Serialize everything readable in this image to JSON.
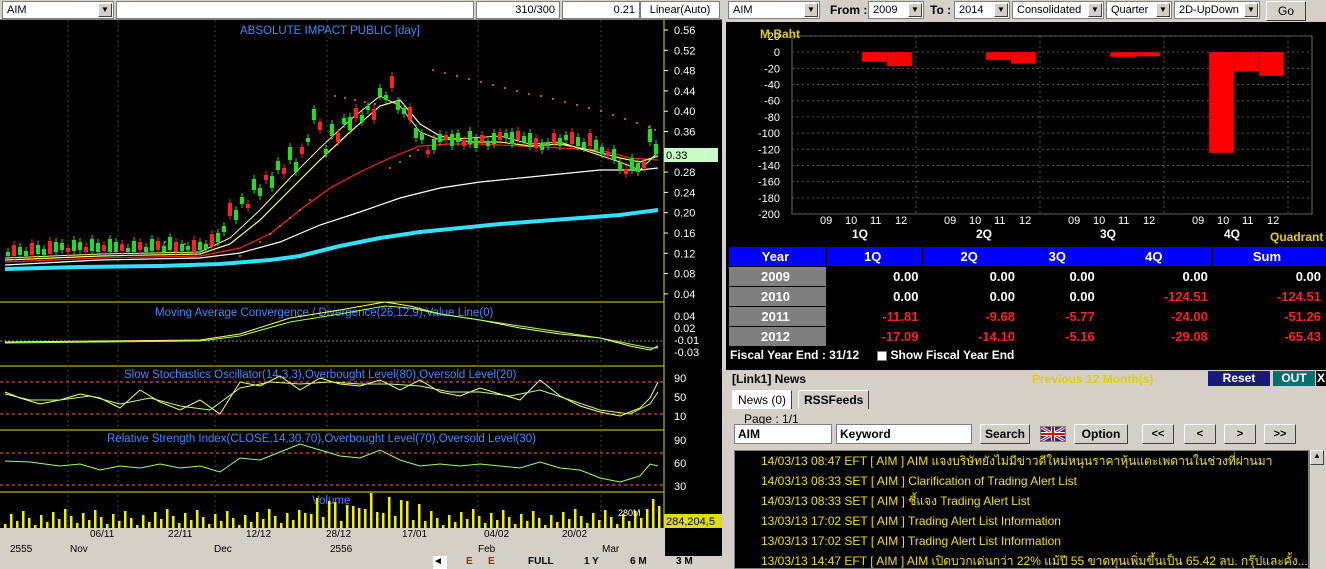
{
  "left": {
    "symbol": "AIM",
    "counter": "310/300",
    "last_value": "0.21",
    "scale_mode": "Linear(Auto)",
    "price_title": "ABSOLUTE IMPACT PUBLIC [day]",
    "price_ticks": [
      "0.56",
      "0.52",
      "0.48",
      "0.44",
      "0.40",
      "0.36",
      "0.32",
      "0.28",
      "0.24",
      "0.20",
      "0.16",
      "0.12",
      "0.08",
      "0.04"
    ],
    "current_price_label": "0.33",
    "macd_title": "Moving Average Convergence / Divergence(26,12,9),Value Line(0)",
    "macd_ticks": [
      "0.04",
      "0.02",
      "-0.01",
      "-0.03"
    ],
    "stoch_title": "Slow Stochastics Oscillator(14,3,3),Overbought Level(80),Oversold Level(20)",
    "stoch_ticks": [
      "90",
      "50",
      "10"
    ],
    "rsi_title": "Relative Strength Index(CLOSE,14,30,70),Overbought Level(70),Oversold Level(30)",
    "rsi_ticks": [
      "90",
      "60",
      "30"
    ],
    "vol_title": "Volume",
    "vol_label": "284,204,5",
    "vol_top_tick": "280M",
    "date_row1": [
      "06/11",
      "22/11",
      "12/12",
      "28/12",
      "17/01",
      "04/02",
      "20/02"
    ],
    "date_row2": [
      "2555",
      "Nov",
      "Dec",
      "2556",
      "Feb",
      "Mar"
    ],
    "bottom_buttons": [
      "E",
      "E",
      "FULL",
      "1 Y",
      "6 M",
      "3 M"
    ]
  },
  "right": {
    "symbol": "AIM",
    "from_label": "From :",
    "from_value": "2009",
    "to_label": "To :",
    "to_value": "2014",
    "consolidated": "Consolidated",
    "period": "Quarter",
    "view": "2D-UpDown",
    "go_label": "Go",
    "chart_unit": "M Baht",
    "quadrant_label": "Quadrant",
    "fiscal_year_end": "Fiscal  Year  End  :  31/12",
    "show_fiscal": "Show Fiscal Year End",
    "table": {
      "headers": [
        "Year",
        "1Q",
        "2Q",
        "3Q",
        "4Q",
        "Sum"
      ],
      "rows": [
        {
          "year": "2009",
          "q1": "0.00",
          "q2": "0.00",
          "q3": "0.00",
          "q4": "0.00",
          "sum": "0.00"
        },
        {
          "year": "2010",
          "q1": "0.00",
          "q2": "0.00",
          "q3": "0.00",
          "q4": "-124.51",
          "sum": "-124.51"
        },
        {
          "year": "2011",
          "q1": "-11.81",
          "q2": "-9.68",
          "q3": "-5.77",
          "q4": "-24.00",
          "sum": "-51.26"
        },
        {
          "year": "2012",
          "q1": "-17.09",
          "q2": "-14.10",
          "q3": "-5.16",
          "q4": "-29.08",
          "sum": "-65.43"
        }
      ]
    },
    "news": {
      "link_title": "[Link1] News",
      "period_text": "Previous 12 Month(s)",
      "reset_label": "Reset",
      "out_label": "OUT",
      "tab_news": "News (0)",
      "tab_rss": "RSSFeeds",
      "page_text": "Page :  1/1",
      "symbol_input": "AIM",
      "keyword_input": "Keyword",
      "search_label": "Search",
      "option_label": "Option",
      "nav": [
        "<<",
        "<",
        ">",
        ">>"
      ],
      "items": [
        "14/03/13 08:47  EFT  [ AIM ]  AIM แจงบริษัทยังไม่มีข่าวดีใหม่หนุนราคาหุ้นแตะเพดานในช่วงที่ผ่านมา",
        "14/03/13 08:33  SET  [ AIM ]  Clarification of Trading Alert List",
        "14/03/13 08:33  SET  [ AIM ]  ชี้แจง Trading Alert List",
        "13/03/13 17:02  SET  [ AIM ]  Trading Alert List Information",
        "13/03/13 17:02  SET  [ AIM ]  Trading Alert List Information",
        "13/03/13 14:47  EFT  [ AIM ]  AIM เปิดบวกเด่นกว่า 22% แม้ปี 55 ขาดทุนเพิ่มขึ้นเป็น 65.42 ลบ. กรุ๊ปและคั้ง..."
      ]
    }
  },
  "chart_data": [
    {
      "type": "bar",
      "ylabel": "M Baht",
      "xlabel": "Quadrant",
      "ylim": [
        -200,
        20
      ],
      "yticks": [
        20,
        0,
        -20,
        -40,
        -60,
        -80,
        -100,
        -120,
        -140,
        -160,
        -180,
        -200
      ],
      "groups": [
        "1Q",
        "2Q",
        "3Q",
        "4Q"
      ],
      "categories": [
        "09",
        "10",
        "11",
        "12"
      ],
      "series": [
        {
          "values": [
            0,
            0,
            -11.81,
            -17.09
          ]
        },
        {
          "values": [
            0,
            0,
            -9.68,
            -14.1
          ]
        },
        {
          "values": [
            0,
            0,
            -5.77,
            -5.16
          ]
        },
        {
          "values": [
            0,
            -124.51,
            -24.0,
            -29.08
          ]
        }
      ],
      "bar_color": "#ff0000",
      "grid": true
    }
  ]
}
